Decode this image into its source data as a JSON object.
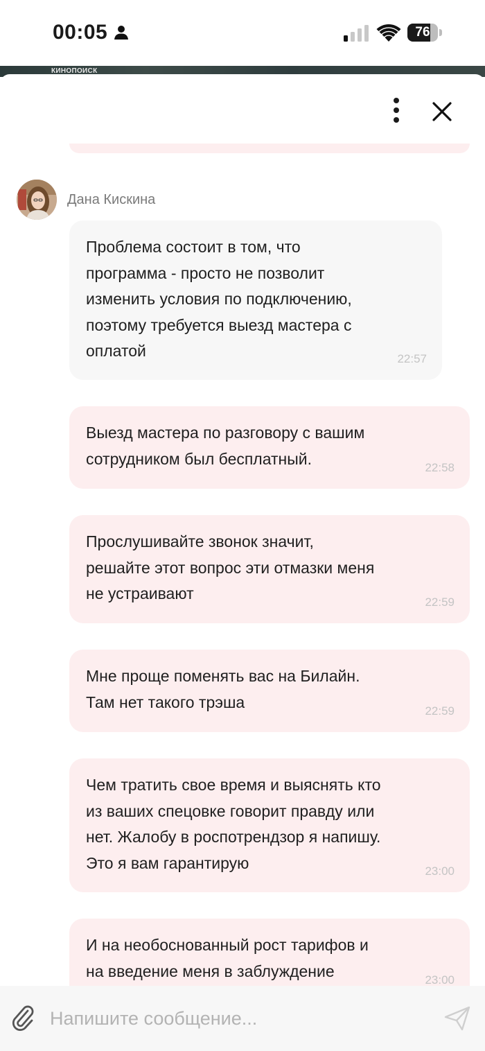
{
  "status_bar": {
    "time": "00:05",
    "battery": "76",
    "battery_level": 0.76
  },
  "banner": {
    "logo": "КИНОПОИСК"
  },
  "chat": {
    "sender_name": "Дана Кискина",
    "messages": [
      {
        "text": "Проблема состоит в том, что\nпрограмма - просто не позволит\nизменить условия по подключению,\nпоэтому требуется выезд мастера с\nоплатой",
        "time": "22:57",
        "direction": "incoming"
      },
      {
        "text": "Выезд мастера по разговору с вашим\nсотрудником был бесплатный.",
        "time": "22:58",
        "direction": "outgoing"
      },
      {
        "text": "Прослушивайте звонок значит,\nрешайте этот вопрос эти отмазки меня\nне устраивают",
        "time": "22:59",
        "direction": "outgoing"
      },
      {
        "text": "Мне проще поменять вас на Билайн.\nТам нет такого трэша",
        "time": "22:59",
        "direction": "outgoing"
      },
      {
        "text": "Чем тратить свое время и выяснять кто\nиз ваших спецовке говорит правду или\nнет. Жалобу в роспотрендзор я напишу.\nЭто я вам гарантирую",
        "time": "23:00",
        "direction": "outgoing"
      },
      {
        "text": "И на необоснованный рост тарифов и\nна введение меня в заблуждение",
        "time": "23:00",
        "direction": "outgoing"
      }
    ]
  },
  "composer": {
    "placeholder": "Напишите сообщение..."
  },
  "colors": {
    "incoming_bubble": "#f7f7f7",
    "outgoing_bubble": "#fdeeef",
    "timestamp": "#c4c4c4",
    "sender_name": "#7a7a7a"
  }
}
